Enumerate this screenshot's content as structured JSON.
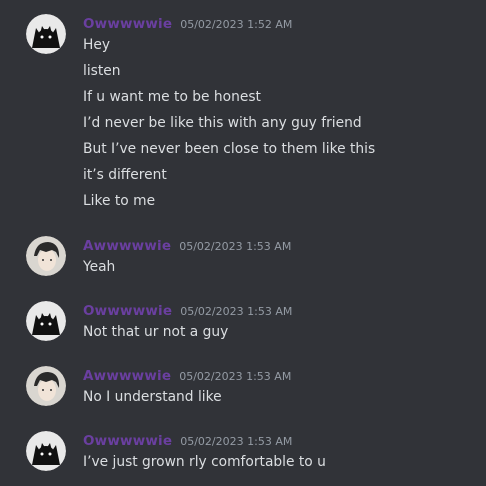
{
  "colors": {
    "background": "#313338",
    "username": "#6a3fa0",
    "timestamp": "#949ba4",
    "text": "#dbdee1"
  },
  "messages": [
    {
      "author": "Owwwwwie",
      "timestamp": "05/02/2023 1:52 AM",
      "avatar": "cat-silhouette-avatar",
      "lines": [
        "Hey",
        "listen",
        "If u want me to be honest",
        "I’d never be like this with any guy friend",
        "But I’ve never been close to them like this",
        "it’s different",
        "Like to me"
      ]
    },
    {
      "author": "Awwwwwie",
      "timestamp": "05/02/2023 1:53 AM",
      "avatar": "anime-boy-avatar",
      "lines": [
        "Yeah"
      ]
    },
    {
      "author": "Owwwwwie",
      "timestamp": "05/02/2023 1:53 AM",
      "avatar": "cat-silhouette-avatar",
      "lines": [
        "Not that ur not a guy"
      ]
    },
    {
      "author": "Awwwwwie",
      "timestamp": "05/02/2023 1:53 AM",
      "avatar": "anime-boy-avatar",
      "lines": [
        "No I understand like"
      ]
    },
    {
      "author": "Owwwwwie",
      "timestamp": "05/02/2023 1:53 AM",
      "avatar": "cat-silhouette-avatar",
      "lines": [
        "I’ve just grown rly comfortable to u"
      ]
    }
  ]
}
